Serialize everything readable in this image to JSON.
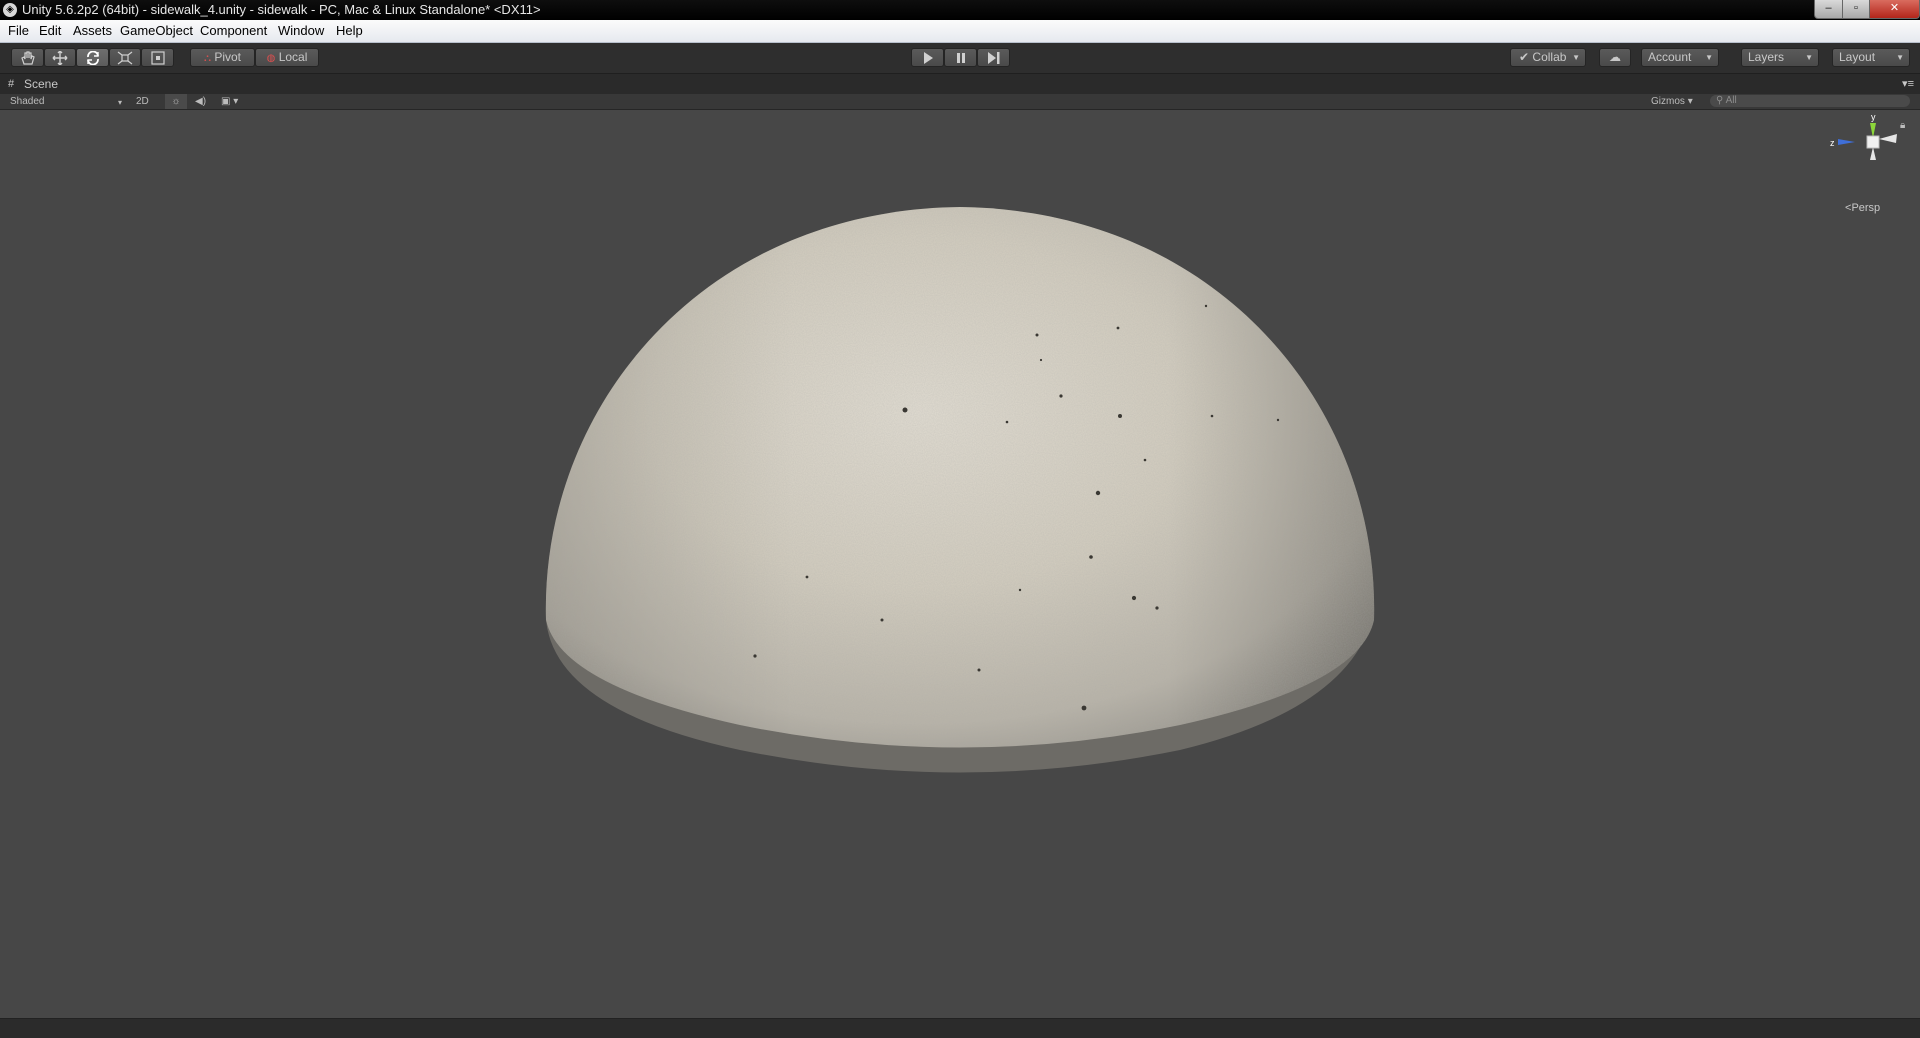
{
  "window": {
    "title": "Unity 5.6.2p2 (64bit) - sidewalk_4.unity - sidewalk - PC, Mac & Linux Standalone* <DX11>",
    "controls": {
      "minimize": "–",
      "maximize": "▫",
      "close": "✕"
    }
  },
  "menu": {
    "items": [
      "File",
      "Edit",
      "Assets",
      "GameObject",
      "Component",
      "Window",
      "Help"
    ]
  },
  "toolbar": {
    "tools": [
      "hand-tool-icon",
      "move-tool-icon",
      "rotate-tool-icon",
      "scale-tool-icon",
      "rect-tool-icon"
    ],
    "active_tool": "rotate-tool-icon",
    "pivot_label": "Pivot",
    "local_label": "Local",
    "collab_label": "Collab",
    "account_label": "Account",
    "layers_label": "Layers",
    "layout_label": "Layout"
  },
  "scene_tab": {
    "label": "Scene"
  },
  "scene_toolbar": {
    "shading_mode": "Shaded",
    "mode_2d": "2D",
    "gizmos_label": "Gizmos",
    "search_placeholder": "All"
  },
  "scene_view": {
    "object": "concrete dome",
    "axis_y": "y",
    "axis_z": "z",
    "projection_label": "Persp",
    "colors": {
      "background": "#474747",
      "dome_light": "#d9d3c5",
      "dome_shadow": "#8e8b83",
      "axis_y": "#8cd63a",
      "axis_z": "#3f6fd9"
    }
  }
}
